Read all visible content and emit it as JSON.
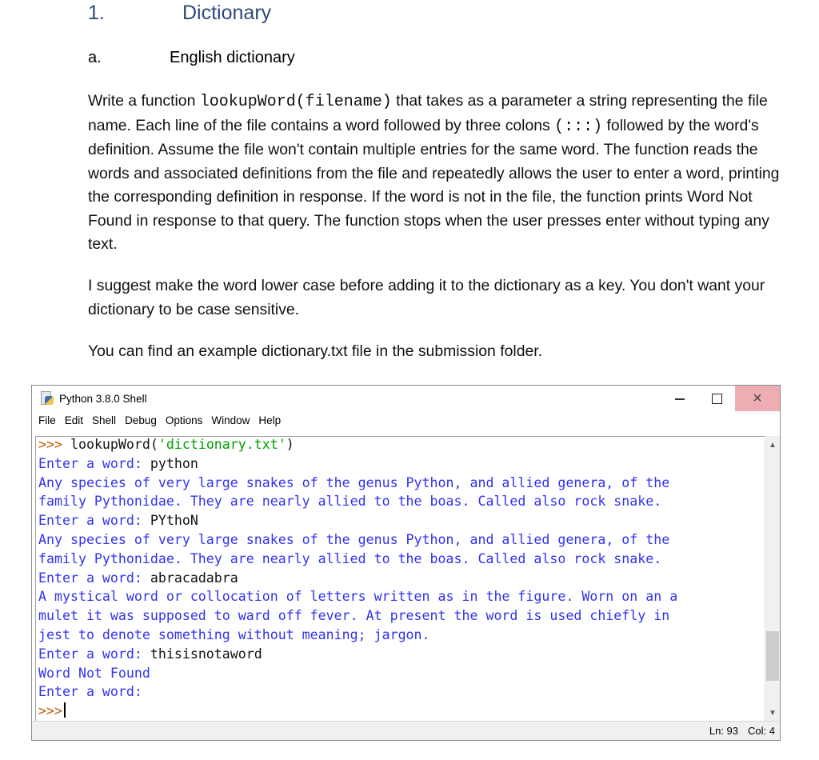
{
  "document": {
    "heading1": {
      "number": "1.",
      "title": "Dictionary"
    },
    "heading2": {
      "number": "a.",
      "title": "English dictionary"
    },
    "paragraph1": {
      "lead": "Write a function ",
      "code": "lookupWord(filename)",
      "after_code": " that takes as a parameter a string representing the file name. Each line of the file contains a word followed by three colons ",
      "colons_code": "(:::)",
      "rest": " followed by the word's definition. Assume the file won't contain multiple entries for the same word. The function reads the words and associated definitions from the file and repeatedly allows the user to enter a word, printing the corresponding definition in response. If the word is not in the file, the function prints Word Not Found in response to that query. The function stops when the user presses enter without typing any text."
    },
    "paragraph2": "I suggest make the word lower case before adding it to the dictionary as a key. You don't want your dictionary to be case sensitive.",
    "paragraph3": "You can find an example dictionary.txt file in the submission folder."
  },
  "window": {
    "title": "Python 3.8.0 Shell",
    "icon": "python-idle-icon",
    "controls": {
      "minimize": "minimize-icon",
      "maximize": "maximize-icon",
      "close": "×"
    },
    "menu": [
      "File",
      "Edit",
      "Shell",
      "Debug",
      "Options",
      "Window",
      "Help"
    ],
    "shell": {
      "prompt": ">>>",
      "command_func": " lookupWord(",
      "command_arg": "'dictionary.txt'",
      "command_close": ")",
      "input_prompt": "Enter a word: ",
      "entries": [
        {
          "input": "python",
          "output": [
            "Any species of very large snakes of the genus Python, and allied genera, of the",
            "family Pythonidae. They are nearly allied to the boas. Called also rock snake."
          ]
        },
        {
          "input": "PYthoN",
          "output": [
            "Any species of very large snakes of the genus Python, and allied genera, of the",
            "family Pythonidae. They are nearly allied to the boas. Called also rock snake."
          ]
        },
        {
          "input": "abracadabra",
          "output": [
            "A mystical word or collocation of letters written as in the figure. Worn on an a",
            "mulet it was supposed to ward off fever. At present the word is used chiefly in",
            "jest to denote something without meaning; jargon."
          ]
        },
        {
          "input": "thisisnotaword",
          "output": [
            "Word Not Found"
          ]
        },
        {
          "input": "",
          "output": []
        }
      ],
      "final_prompt": ">>>"
    },
    "scrollbar": {
      "up": "^",
      "down": "v",
      "position_fraction": 0.88
    },
    "status": {
      "line": "Ln: 93",
      "col": "Col: 4"
    }
  }
}
